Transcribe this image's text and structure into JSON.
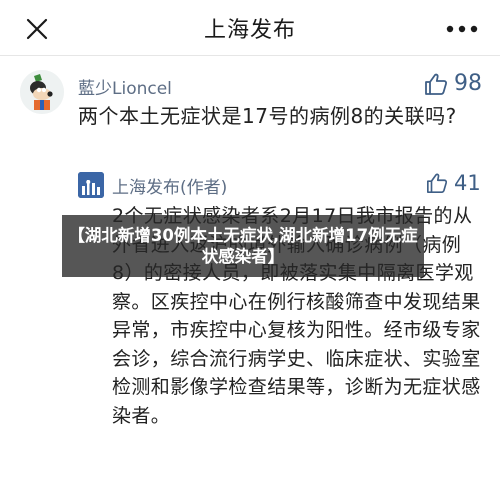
{
  "header": {
    "title": "上海发布",
    "close_icon": "close-icon",
    "more_icon": "more-icon"
  },
  "comment": {
    "username": "藍少Lioncel",
    "likes": "98",
    "text": "两个本土无症状是17号的病例8的关联吗?"
  },
  "reply": {
    "username": "上海发布(作者)",
    "likes": "41",
    "text": "2个无症状感染者系2月17日我市报告的从外省进入返沪的境外输入确诊病例（病例8）的密接人员，即被落实集中隔离医学观察。区疾控中心在例行核酸筛查中发现结果异常，市疾控中心复核为阳性。经市级专家会诊，综合流行病学史、临床症状、实验室检测和影像学检查结果等，诊断为无症状感染者。"
  },
  "banner": {
    "text": "【湖北新增30例本土无症状,湖北新增17例无症状感染者】"
  },
  "colors": {
    "link_blue": "#5e6e85",
    "like_blue": "#3f5f86",
    "text": "#222222"
  }
}
